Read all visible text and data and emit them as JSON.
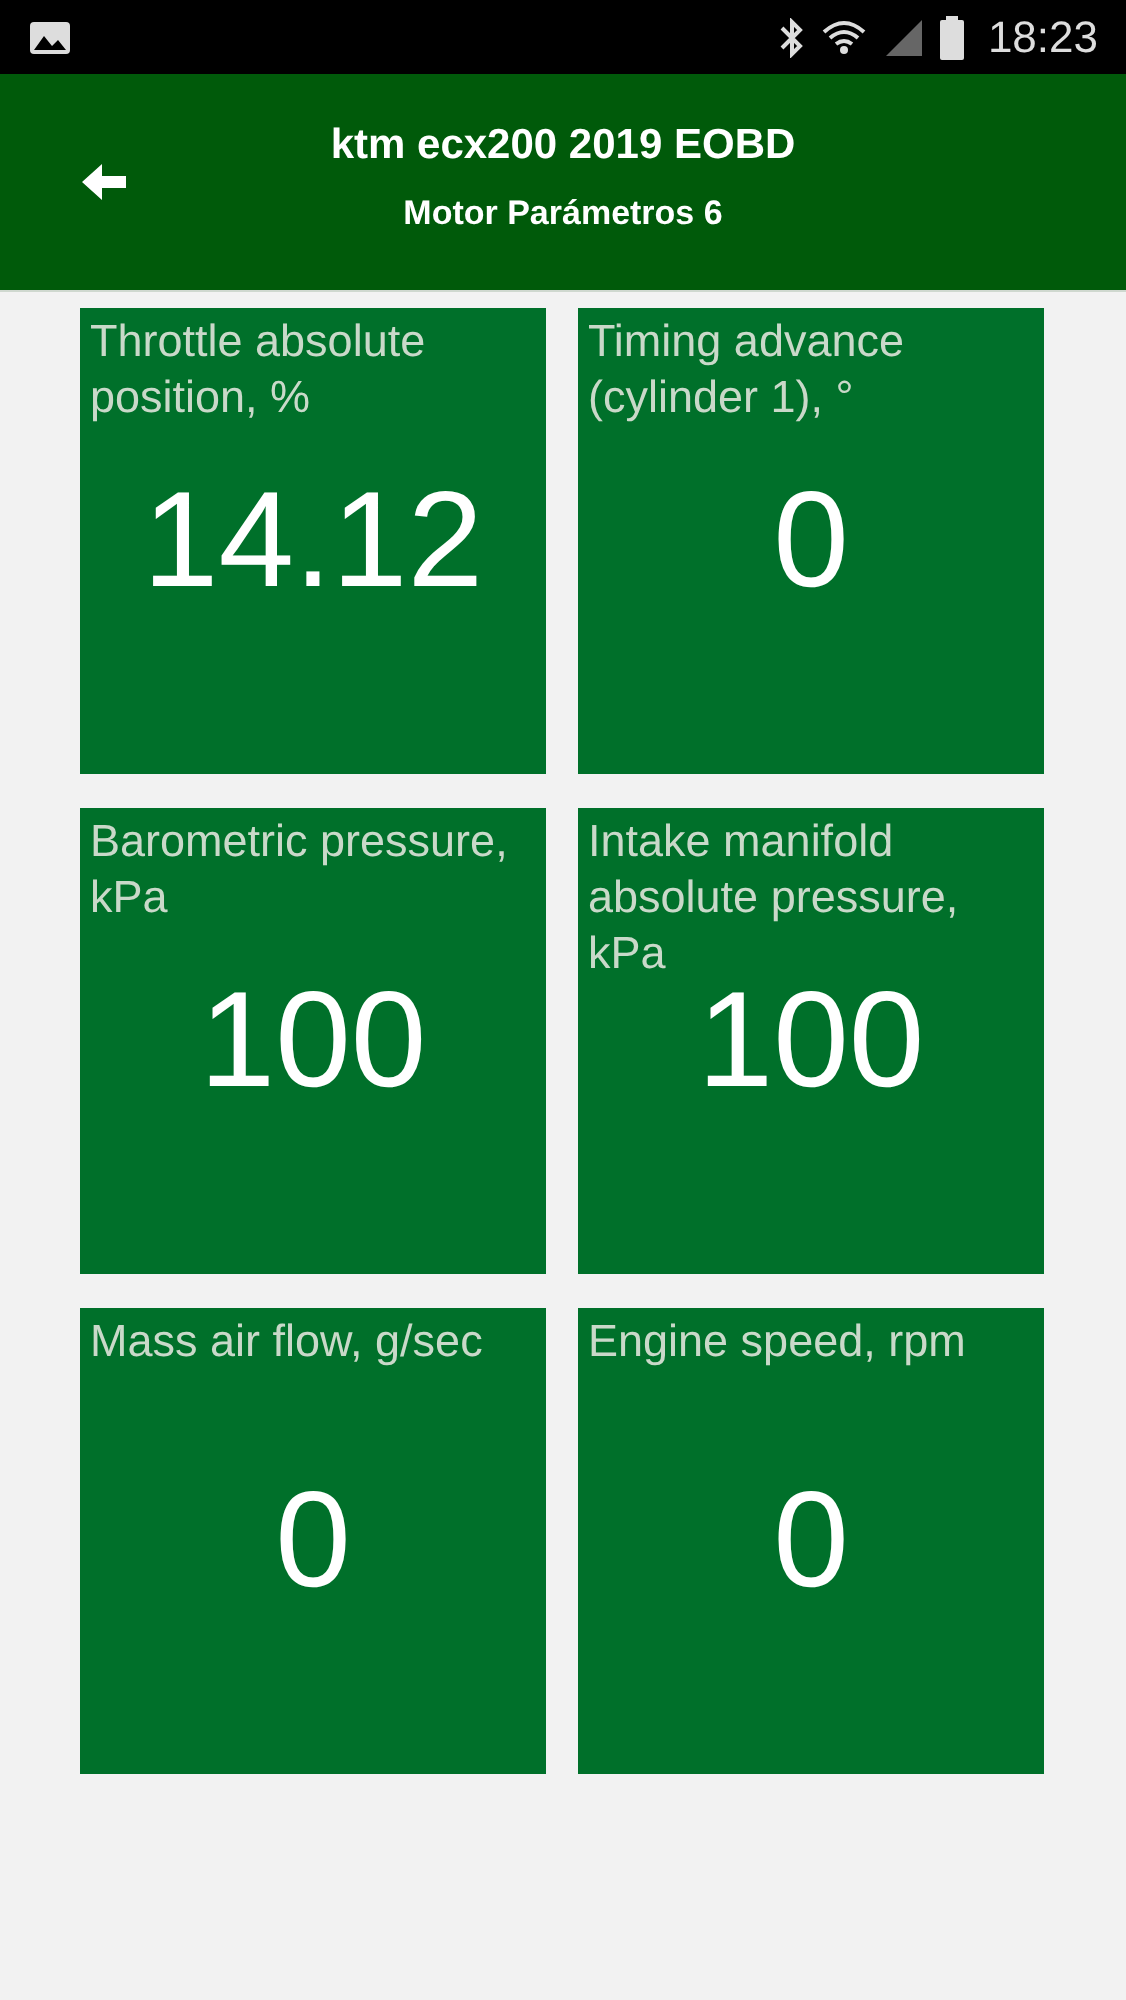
{
  "status_bar": {
    "time": "18:23"
  },
  "header": {
    "title": "ktm ecx200 2019 EOBD",
    "subtitle": "Motor Parámetros 6"
  },
  "tiles": [
    {
      "label": "Throttle absolute position, %",
      "value": "14.12"
    },
    {
      "label": "Timing advance (cylinder 1), °",
      "value": "0"
    },
    {
      "label": "Barometric pressure, kPa",
      "value": "100"
    },
    {
      "label": "Intake manifold absolute pressure, kPa",
      "value": "100"
    },
    {
      "label": "Mass air flow, g/sec",
      "value": "0"
    },
    {
      "label": "Engine speed, rpm",
      "value": "0"
    }
  ]
}
